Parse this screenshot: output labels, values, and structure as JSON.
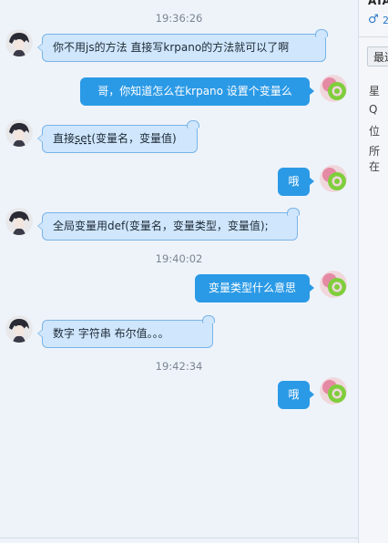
{
  "timestamps": [
    "19:36:26",
    "19:40:02",
    "19:42:34"
  ],
  "messages": [
    {
      "side": "left",
      "text": "你不用js的方法  直接写krpano的方法就可以了啊"
    },
    {
      "side": "right",
      "text": "哥，你知道怎么在krpano 设置个变量么"
    },
    {
      "side": "left",
      "text_before": "直接",
      "text_underlined": "set",
      "text_after": "(变量名，变量值)"
    },
    {
      "side": "right",
      "text": "哦"
    },
    {
      "side": "left",
      "text": "全局变量用def(变量名，变量类型，变量值);"
    },
    {
      "side": "right",
      "text": "变量类型什么意思"
    },
    {
      "side": "left",
      "text": "数字  字符串  布尔值。。。"
    },
    {
      "side": "right",
      "text": "哦"
    }
  ],
  "side_panel": {
    "title": "ATA",
    "gender_symbol": "♂",
    "gender_extra": "2",
    "recent_button": "最近",
    "labels": [
      "星",
      "Q",
      "位",
      "所在"
    ]
  },
  "colors": {
    "left_bubble": "#cfe6fc",
    "right_bubble": "#2b9ae6",
    "background": "#eef3fa"
  },
  "icons": {
    "left_avatar": "anime-avatar",
    "right_avatar": "green-ring-avatar"
  }
}
